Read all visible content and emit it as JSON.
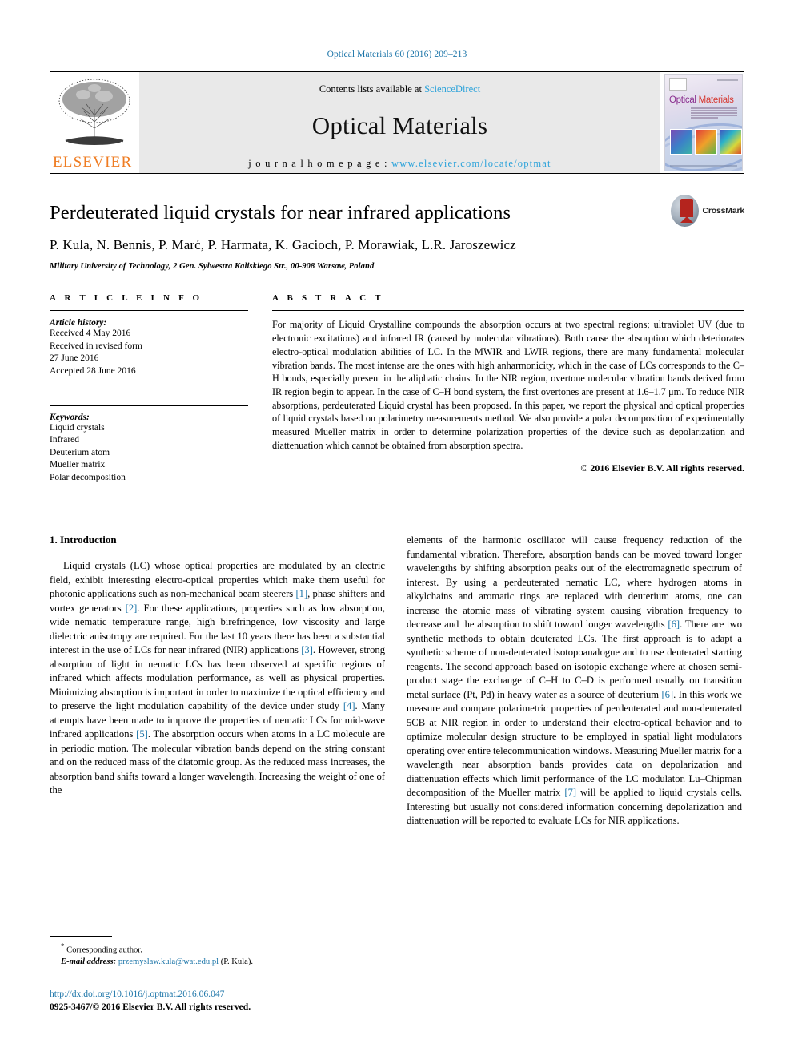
{
  "running_head": "Optical Materials 60 (2016) 209–213",
  "masthead": {
    "publisher_name": "ELSEVIER",
    "contents_prefix": "Contents lists available at ",
    "contents_link": "ScienceDirect",
    "journal_title": "Optical Materials",
    "homepage_label": "j o u r n a l   h o m e p a g e :   ",
    "homepage_url": "www.elsevier.com/locate/optmat",
    "cover_title_a": "Optical",
    "cover_title_b": "Materials"
  },
  "article": {
    "title": "Perdeuterated liquid crystals for near infrared applications",
    "authors": "P. Kula, N. Bennis, P. Marć, P. Harmata, K. Gacioch, P. Morawiak, L.R. Jaroszewicz",
    "author_star": "*",
    "affiliation": "Military University of Technology, 2 Gen. Sylwestra Kaliskiego Str., 00-908 Warsaw, Poland",
    "crossmark_label": "CrossMark"
  },
  "article_info": {
    "heading": "A R T I C L E   I N F O",
    "history_label": "Article history:",
    "history": [
      "Received 4 May 2016",
      "Received in revised form",
      "27 June 2016",
      "Accepted 28 June 2016"
    ],
    "keywords_label": "Keywords:",
    "keywords": [
      "Liquid crystals",
      "Infrared",
      "Deuterium atom",
      "Mueller matrix",
      "Polar decomposition"
    ]
  },
  "abstract": {
    "heading": "A B S T R A C T",
    "text": "For majority of Liquid Crystalline compounds the absorption occurs at two spectral regions; ultraviolet UV (due to electronic excitations) and infrared IR (caused by molecular vibrations). Both cause the absorption which deteriorates electro-optical modulation abilities of LC. In the MWIR and LWIR regions, there are many fundamental molecular vibration bands. The most intense are the ones with high anharmonicity, which in the case of LCs corresponds to the C–H bonds, especially present in the aliphatic chains. In the NIR region, overtone molecular vibration bands derived from IR region begin to appear. In the case of C–H bond system, the first overtones are present at 1.6–1.7 μm. To reduce NIR absorptions, perdeuterated Liquid crystal has been proposed. In this paper, we report the physical and optical properties of liquid crystals based on polarimetry measurements method. We also provide a polar decomposition of experimentally measured Mueller matrix in order to determine polarization properties of the device such as depolarization and diattenuation which cannot be obtained from absorption spectra.",
    "copyright": "© 2016 Elsevier B.V. All rights reserved."
  },
  "introduction": {
    "heading": "1. Introduction",
    "left_paragraph_part1": "Liquid crystals (LC) whose optical properties are modulated by an electric field, exhibit interesting electro-optical properties which make them useful for photonic applications such as non-mechanical beam steerers ",
    "ref1": "[1]",
    "left_paragraph_part2": ", phase shifters and vortex generators ",
    "ref2": "[2]",
    "left_paragraph_part3": ". For these applications, properties such as low absorption, wide nematic temperature range, high birefringence, low viscosity and large dielectric anisotropy are required. For the last 10 years there has been a substantial interest in the use of LCs for near infrared (NIR) applications ",
    "ref3": "[3]",
    "left_paragraph_part4": ". However, strong absorption of light in nematic LCs has been observed at specific regions of infrared which affects modulation performance, as well as physical properties. Minimizing absorption is important in order to maximize the optical efficiency and to preserve the light modulation capability of the device under study ",
    "ref4": "[4]",
    "left_paragraph_part5": ". Many attempts have been made to improve the properties of nematic LCs for mid-wave infrared applications ",
    "ref5": "[5]",
    "left_paragraph_part6": ". The absorption occurs when atoms in a LC molecule are in periodic motion. The molecular vibration bands depend on the string constant and on the reduced mass of the diatomic group. As the reduced mass increases, the absorption band shifts toward a longer wavelength. Increasing the weight of one of the",
    "right_paragraph_part1": "elements of the harmonic oscillator will cause frequency reduction of the fundamental vibration. Therefore, absorption bands can be moved toward longer wavelengths by shifting absorption peaks out of the electromagnetic spectrum of interest. By using a perdeuterated nematic LC, where hydrogen atoms in alkylchains and aromatic rings are replaced with deuterium atoms, one can increase the atomic mass of vibrating system causing vibration frequency to decrease and the absorption to shift toward longer wavelengths ",
    "ref6a": "[6]",
    "right_paragraph_part2": ". There are two synthetic methods to obtain deuterated LCs. The first approach is to adapt a synthetic scheme of non-deuterated isotopoanalogue and to use deuterated starting reagents. The second approach based on isotopic exchange where at chosen semi-product stage the exchange of C–H to C–D is performed usually on transition metal surface (Pt, Pd) in heavy water as a source of deuterium ",
    "ref6b": "[6]",
    "right_paragraph_part3": ". In this work we measure and compare polarimetric properties of perdeuterated and non-deuterated 5CB at NIR region in order to understand their electro-optical behavior and to optimize molecular design structure to be employed in spatial light modulators operating over entire telecommunication windows. Measuring Mueller matrix for a wavelength near absorption bands provides data on depolarization and diattenuation effects which limit performance of the LC modulator. Lu–Chipman decomposition of the Mueller matrix ",
    "ref7": "[7]",
    "right_paragraph_part4": " will be applied to liquid crystals cells. Interesting but usually not considered information concerning depolarization and diattenuation will be reported to evaluate LCs for NIR applications."
  },
  "footer": {
    "corresponding_star": "*",
    "corresponding_label": "Corresponding author.",
    "email_label": "E-mail address:",
    "email": "przemyslaw.kula@wat.edu.pl",
    "email_suffix": " (P. Kula).",
    "doi": "http://dx.doi.org/10.1016/j.optmat.2016.06.047",
    "issn": "0925-3467/© 2016 Elsevier B.V. All rights reserved."
  },
  "colors": {
    "link": "#1b74a8",
    "science_direct": "#2da3da",
    "elsevier_orange": "#ef7c22",
    "banner_bg": "#e9e9e9"
  }
}
